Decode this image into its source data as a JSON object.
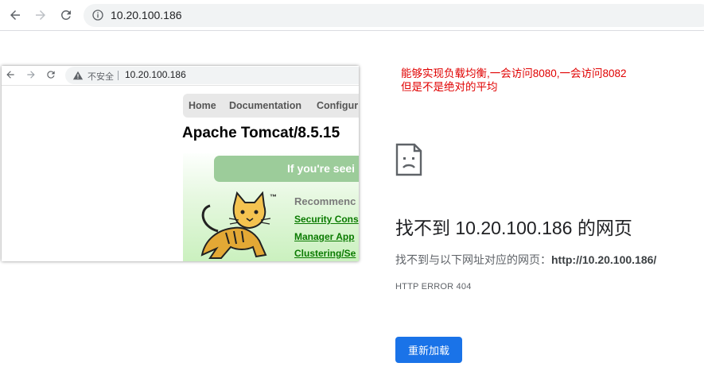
{
  "browser": {
    "url": "10.20.100.186",
    "icons": [
      "back-arrow-icon",
      "forward-arrow-icon",
      "reload-icon",
      "info-icon"
    ]
  },
  "screenshot": {
    "insecure_label": "不安全",
    "url": "10.20.100.186",
    "nav": [
      "Home",
      "Documentation",
      "Configur"
    ],
    "title": "Apache Tomcat/8.5.15",
    "banner": "If you're seei",
    "trademark": "™",
    "recommended": "Recommenc",
    "links": [
      "Security Cons",
      "Manager App",
      "Clustering/Se"
    ]
  },
  "annotation": {
    "line1": "能够实现负载均衡,一会访问8080,一会访问8082",
    "line2": "但是不是绝对的平均",
    "color": "#e00000"
  },
  "error": {
    "title": "找不到 10.20.100.186 的网页",
    "detail_prefix": "找不到与以下网址对应的网页：",
    "detail_url": "http://10.20.100.186/",
    "code": "HTTP ERROR 404",
    "reload_label": "重新加载",
    "accent": "#1a73e8"
  }
}
